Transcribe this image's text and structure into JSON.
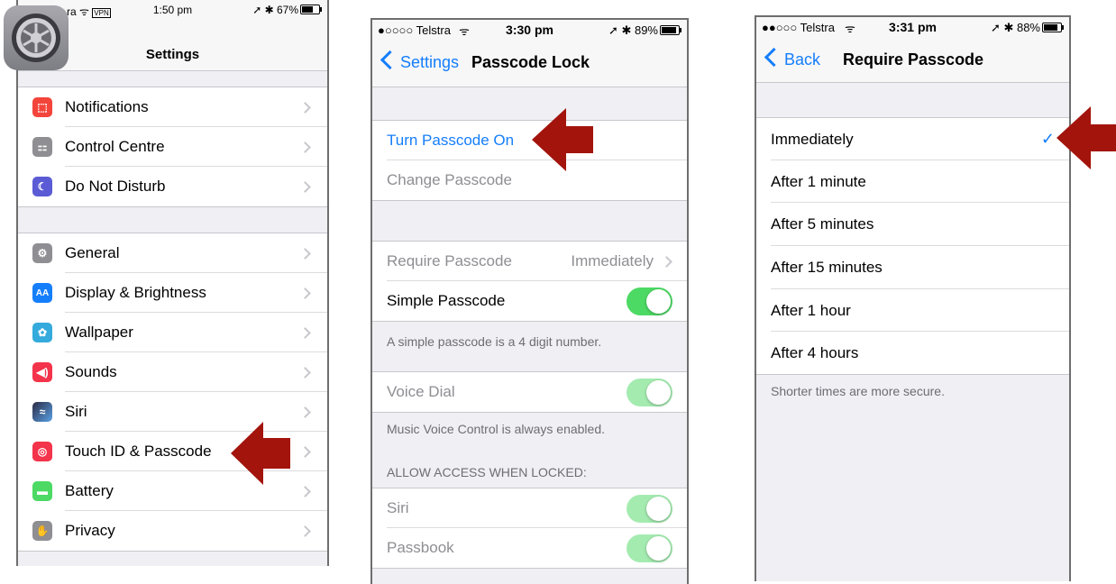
{
  "colors": {
    "accent": "#157efb",
    "toggle_on": "#4cd964",
    "arrow": "#a3140c"
  },
  "panel1": {
    "status": {
      "carrier": "ra",
      "vpn": "VPN",
      "time": "1:50 pm",
      "battery": "67%"
    },
    "title": "Settings",
    "app_icon": "settings-gear-icon",
    "group1": [
      {
        "label": "Notifications",
        "icon": "notifications-icon",
        "color": "#f3453b"
      },
      {
        "label": "Control Centre",
        "icon": "control-centre-icon",
        "color": "#8e8e93"
      },
      {
        "label": "Do Not Disturb",
        "icon": "moon-icon",
        "color": "#5b5cd5"
      }
    ],
    "group2": [
      {
        "label": "General",
        "icon": "gear-icon",
        "color": "#8e8e93"
      },
      {
        "label": "Display & Brightness",
        "icon": "display-icon",
        "color": "#157efb"
      },
      {
        "label": "Wallpaper",
        "icon": "wallpaper-icon",
        "color": "#35aadc"
      },
      {
        "label": "Sounds",
        "icon": "speaker-icon",
        "color": "#f3344b"
      },
      {
        "label": "Siri",
        "icon": "siri-icon",
        "color": "#2b2b44"
      },
      {
        "label": "Touch ID & Passcode",
        "icon": "fingerprint-icon",
        "color": "#f3344b"
      },
      {
        "label": "Battery",
        "icon": "battery-icon",
        "color": "#4cd964"
      },
      {
        "label": "Privacy",
        "icon": "hand-icon",
        "color": "#8e8e93"
      }
    ]
  },
  "panel2": {
    "status": {
      "carrier": "●○○○○ Telstra",
      "time": "3:30 pm",
      "battery": "89%"
    },
    "back": "Settings",
    "title": "Passcode Lock",
    "turn_on": "Turn Passcode On",
    "change": "Change Passcode",
    "require_label": "Require Passcode",
    "require_value": "Immediately",
    "simple": "Simple Passcode",
    "simple_footer": "A simple passcode is a 4 digit number.",
    "voice_dial": "Voice Dial",
    "voice_footer": "Music Voice Control is always enabled.",
    "allow_header": "ALLOW ACCESS WHEN LOCKED:",
    "siri": "Siri",
    "passbook": "Passbook"
  },
  "panel3": {
    "status": {
      "carrier": "●●○○○ Telstra",
      "time": "3:31 pm",
      "battery": "88%"
    },
    "back": "Back",
    "title": "Require Passcode",
    "options": [
      "Immediately",
      "After 1 minute",
      "After 5 minutes",
      "After 15 minutes",
      "After 1 hour",
      "After 4 hours"
    ],
    "selected": "Immediately",
    "footer": "Shorter times are more secure."
  }
}
